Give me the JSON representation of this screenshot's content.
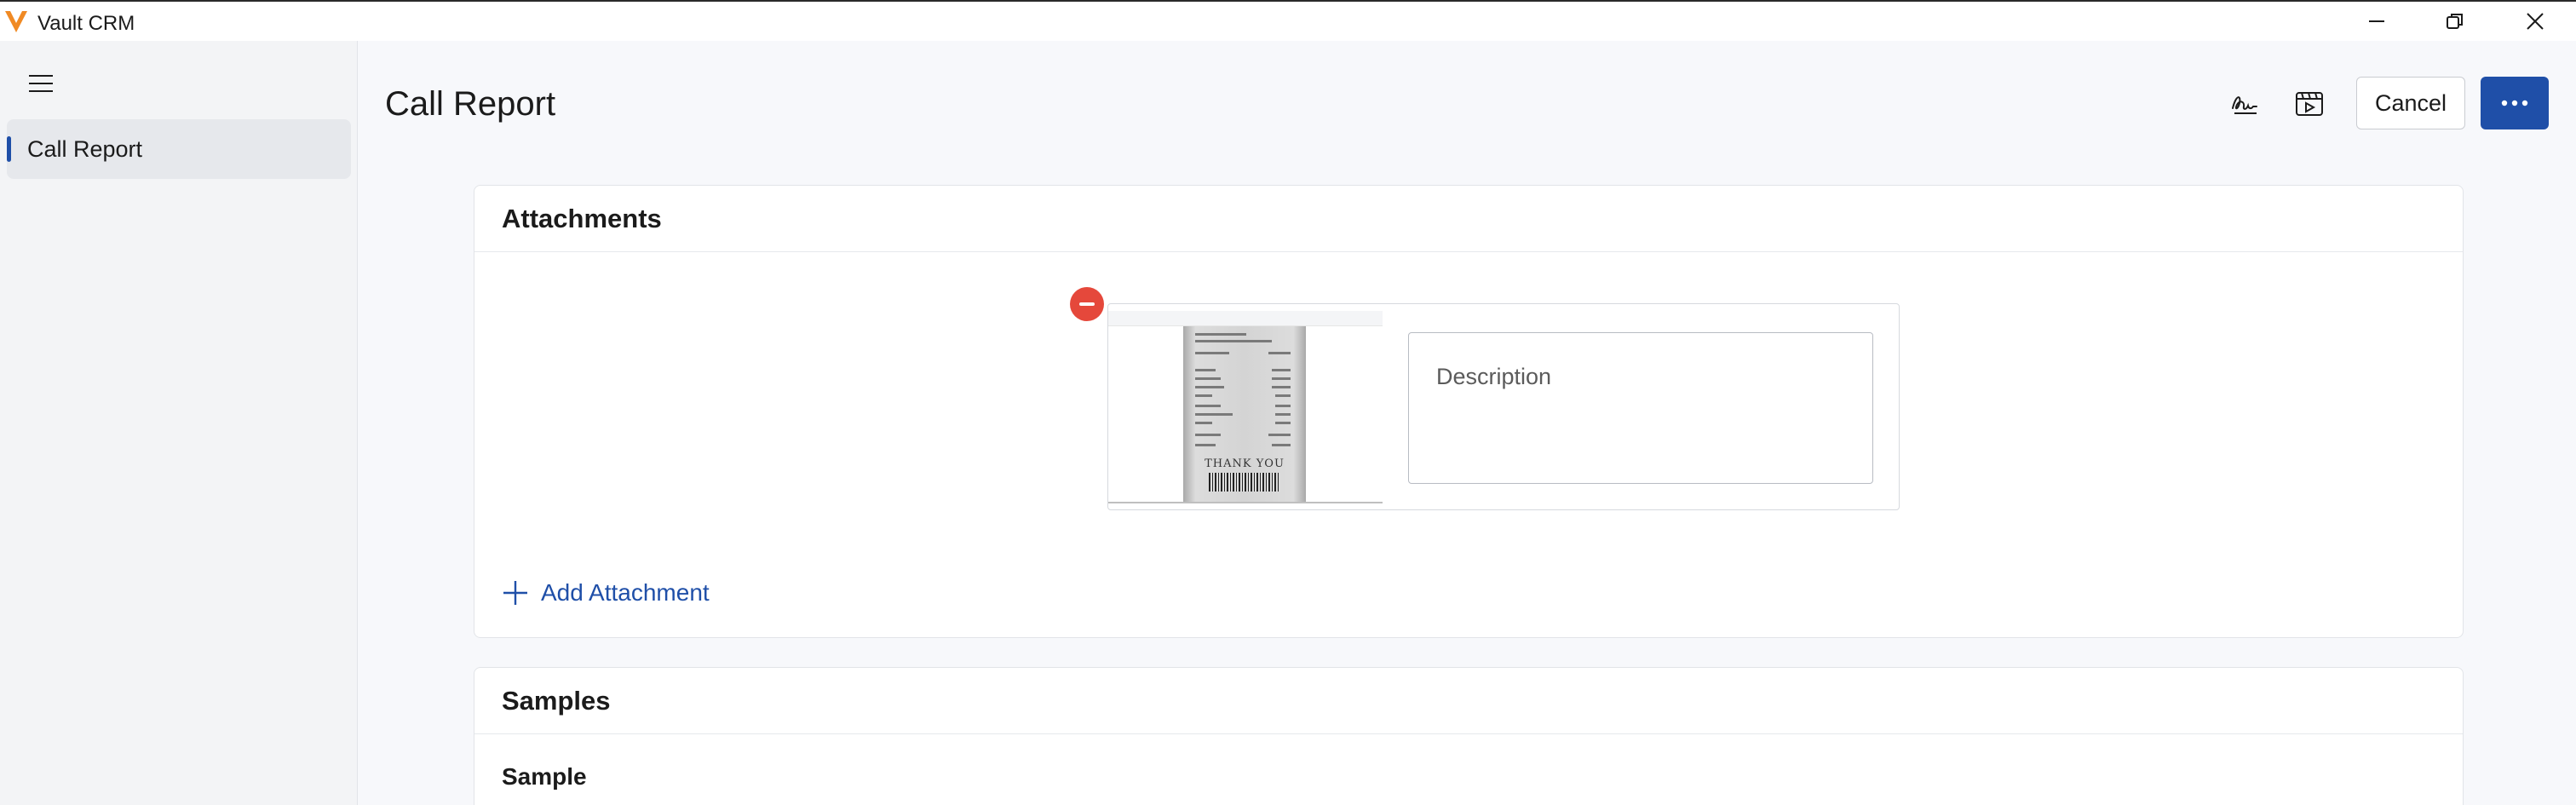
{
  "app": {
    "title": "Vault CRM",
    "brand_color": "#f08a24"
  },
  "sidebar": {
    "items": [
      {
        "label": "Call Report",
        "selected": true
      }
    ]
  },
  "header": {
    "title": "Call Report",
    "cancel_label": "Cancel",
    "accent": "#1f4fa8"
  },
  "attachments": {
    "title": "Attachments",
    "items": [
      {
        "thumbnail_text": "THANK YOU",
        "description_placeholder": "Description"
      }
    ],
    "add_label": "Add Attachment"
  },
  "samples": {
    "title": "Samples",
    "field_label": "Sample"
  },
  "icons": {
    "logo": "vault-v-logo",
    "minimize": "minimize-icon",
    "maximize": "restore-icon",
    "close": "close-icon",
    "menu": "hamburger-icon",
    "signature": "signature-icon",
    "media": "media-icon",
    "more": "more-icon",
    "remove": "remove-icon",
    "add": "plus-icon"
  }
}
